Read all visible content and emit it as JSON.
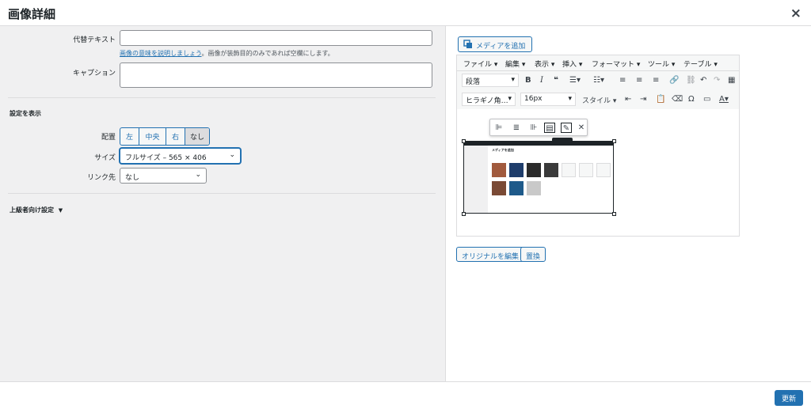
{
  "header": {
    "title": "画像詳細",
    "close": "×"
  },
  "alt_text": {
    "label": "代替テキスト",
    "value": "",
    "help_link": "画像の意味を説明しましょう",
    "help_rest": "。画像が装飾目的のみであれば空欄にします。"
  },
  "caption": {
    "label": "キャプション",
    "value": ""
  },
  "display": {
    "heading": "設定を表示",
    "alignment": {
      "label": "配置",
      "options": [
        "左",
        "中央",
        "右",
        "なし"
      ],
      "selected": "なし"
    },
    "size": {
      "label": "サイズ",
      "value": "フルサイズ – 565 × 406"
    },
    "link": {
      "label": "リンク先",
      "value": "なし"
    }
  },
  "advanced": {
    "label": "上級者向け設定",
    "caret": "▼"
  },
  "editor": {
    "add_media": "メディアを追加",
    "menus": [
      "ファイル ▾",
      "編集 ▾",
      "表示 ▾",
      "挿入 ▾",
      "フォーマット ▾",
      "ツール ▾",
      "テーブル ▾"
    ],
    "format_select": "段落",
    "font_select": "ヒラギノ角…",
    "size_select": "16px",
    "style_menu": "スタイル ▾",
    "tooltip": "編集",
    "preview_title": "メディアを追加"
  },
  "buttons": {
    "edit_original": "オリジナルを編集",
    "replace": "置換",
    "update": "更新"
  },
  "colors": {
    "accent": "#2271b1",
    "pane_bg": "#f0f0f1",
    "border": "#dcdcde"
  }
}
